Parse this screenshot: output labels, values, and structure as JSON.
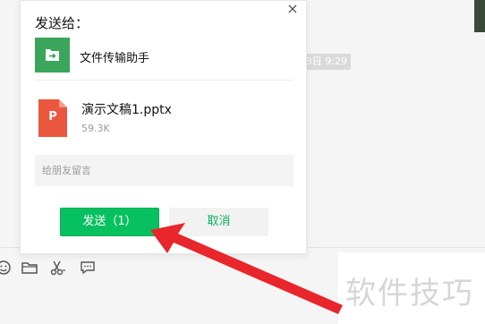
{
  "chat": {
    "timestamp": "3日 9:29"
  },
  "dialog": {
    "title": "发送给：",
    "close_label": "×",
    "contact_name": "文件传输助手",
    "file_name": "演示文稿1.pptx",
    "file_size": "59.3K",
    "file_badge": "P",
    "message_placeholder": "给朋友留言",
    "send_label": "发送（1）",
    "cancel_label": "取消"
  },
  "toolbar": {
    "icons": [
      "emoji-icon",
      "folder-icon",
      "scissors-icon",
      "chat-bubble-icon"
    ]
  },
  "watermark": "软件技巧",
  "colors": {
    "accent_green": "#07c160",
    "folder_green": "#3ba55b",
    "ppt_orange": "#e9573e",
    "arrow_red": "#e8262b"
  }
}
